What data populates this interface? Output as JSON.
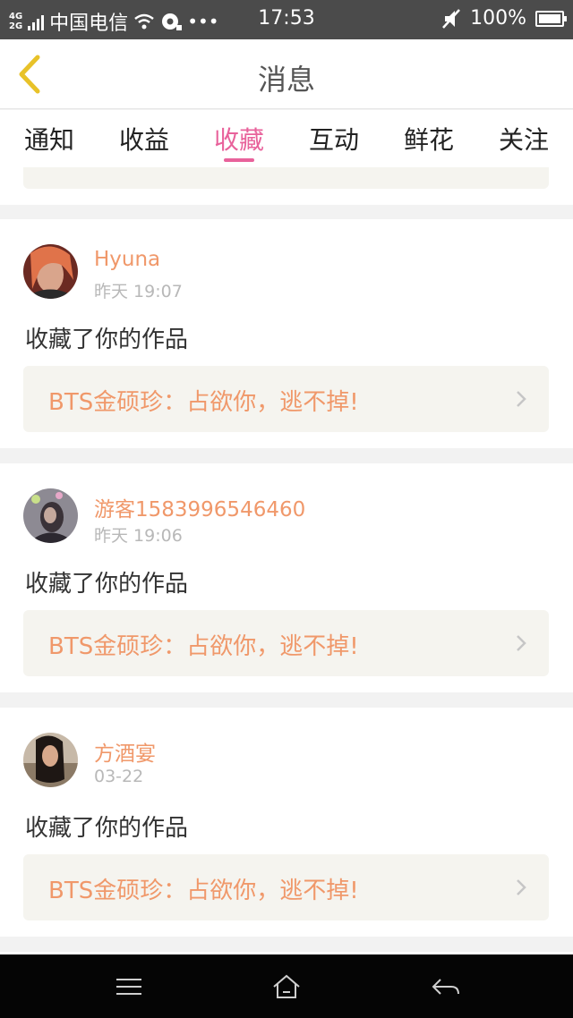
{
  "status_bar": {
    "network_top": "4G",
    "network_bottom": "2G",
    "carrier": "中国电信",
    "time": "17:53",
    "battery": "100%",
    "more_dots": "•••"
  },
  "header": {
    "title": "消息"
  },
  "tabs": [
    {
      "label": "通知",
      "active": false
    },
    {
      "label": "收益",
      "active": false
    },
    {
      "label": "收藏",
      "active": true
    },
    {
      "label": "互动",
      "active": false
    },
    {
      "label": "鲜花",
      "active": false
    },
    {
      "label": "关注",
      "active": false
    }
  ],
  "messages": [
    {
      "user": "Hyuna",
      "time": "昨天 19:07",
      "action": "收藏了你的作品",
      "work_title": "BTS金硕珍：占欲你，逃不掉!"
    },
    {
      "user": "游客1583996546460",
      "time": "昨天 19:06",
      "action": "收藏了你的作品",
      "work_title": "BTS金硕珍：占欲你，逃不掉!"
    },
    {
      "user": "方酒宴",
      "time": "03-22",
      "action": "收藏了你的作品",
      "work_title": "BTS金硕珍：占欲你，逃不掉!"
    }
  ],
  "colors": {
    "accent_pink": "#e8629b",
    "name_orange": "#f0986a",
    "back_yellow": "#e8c229"
  },
  "icons": {
    "back": "chevron-left-icon",
    "menu": "menu-icon",
    "home": "home-icon",
    "return": "back-arrow-icon"
  }
}
